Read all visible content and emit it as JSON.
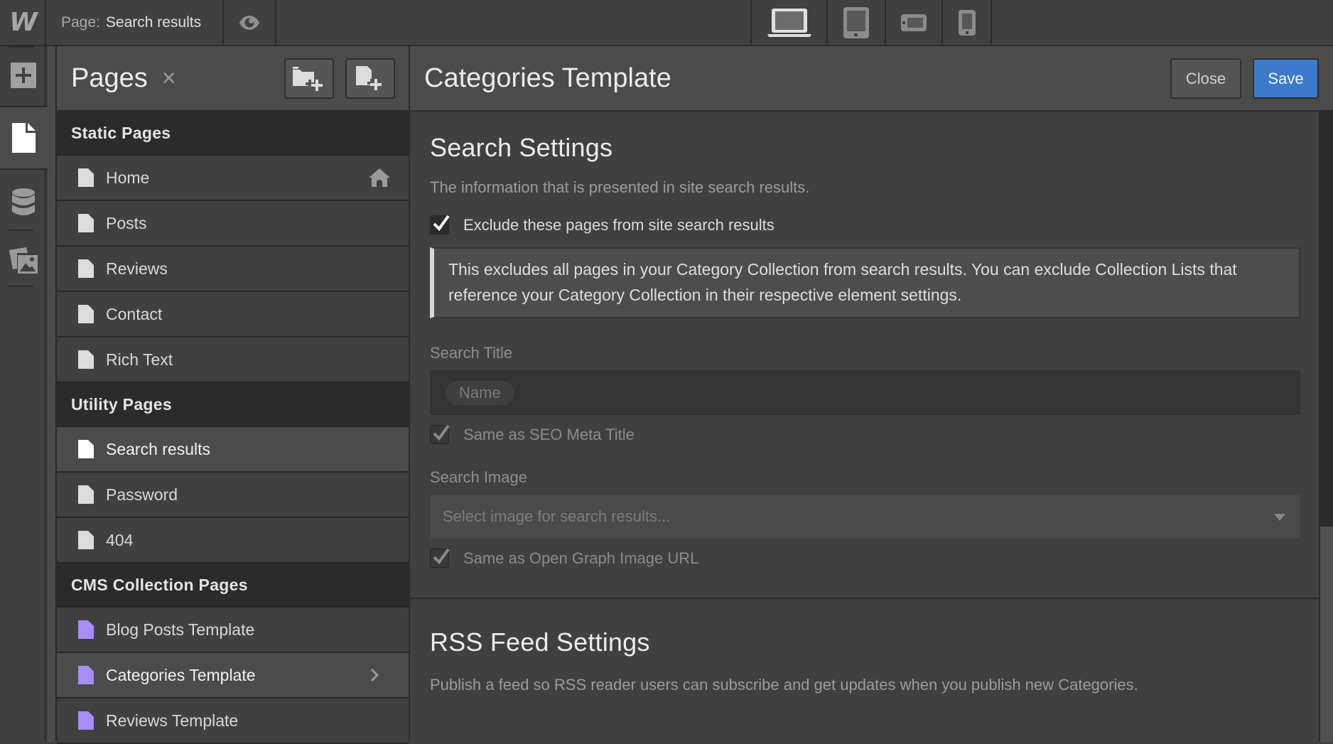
{
  "topbar": {
    "logo": "W",
    "page_prefix": "Page:",
    "page_name": "Search results",
    "preview_icon": "eye-icon",
    "devices": [
      {
        "name": "desktop",
        "icon": "laptop-icon",
        "active": true
      },
      {
        "name": "tablet",
        "icon": "tablet-icon",
        "active": false
      },
      {
        "name": "mobile-landscape",
        "icon": "phone-landscape-icon",
        "active": false
      },
      {
        "name": "mobile-portrait",
        "icon": "phone-portrait-icon",
        "active": false
      }
    ]
  },
  "rail": {
    "items": [
      {
        "name": "add-elements",
        "icon": "plus-icon",
        "active": false
      },
      {
        "name": "pages",
        "icon": "page-icon",
        "active": true
      },
      {
        "name": "cms",
        "icon": "database-icon",
        "active": false
      },
      {
        "name": "assets",
        "icon": "images-icon",
        "active": false
      }
    ]
  },
  "pages_panel": {
    "title": "Pages",
    "close_glyph": "×",
    "add_folder_icon": "folder-plus-icon",
    "add_page_icon": "page-plus-icon",
    "sections": [
      {
        "title": "Static Pages",
        "items": [
          {
            "label": "Home",
            "home": true
          },
          {
            "label": "Posts"
          },
          {
            "label": "Reviews"
          },
          {
            "label": "Contact"
          },
          {
            "label": "Rich Text"
          }
        ]
      },
      {
        "title": "Utility Pages",
        "items": [
          {
            "label": "Search results",
            "active": true
          },
          {
            "label": "Password"
          },
          {
            "label": "404"
          }
        ]
      },
      {
        "title": "CMS Collection Pages",
        "items": [
          {
            "label": "Blog Posts Template",
            "cms": true
          },
          {
            "label": "Categories Template",
            "cms": true,
            "active": true,
            "chevron": true
          },
          {
            "label": "Reviews Template",
            "cms": true
          }
        ]
      }
    ]
  },
  "settings": {
    "title": "Categories Template",
    "close_label": "Close",
    "save_label": "Save",
    "scroll_position": 0.66,
    "search": {
      "heading": "Search Settings",
      "description": "The information that is presented in site search results.",
      "exclude_label": "Exclude these pages from site search results",
      "exclude_checked": true,
      "note": "This excludes all pages in your Category Collection from search results. You can exclude Collection Lists that reference your Category Collection in their respective element settings.",
      "title_label": "Search Title",
      "title_token": "Name",
      "same_seo_label": "Same as SEO Meta Title",
      "same_seo_checked": true,
      "image_label": "Search Image",
      "image_placeholder": "Select image for search results...",
      "same_og_label": "Same as Open Graph Image URL",
      "same_og_checked": true
    },
    "rss": {
      "heading": "RSS Feed Settings",
      "description": "Publish a feed so RSS reader users can subscribe and get updates when you publish new Categories."
    }
  },
  "colors": {
    "accent": "#3b7bc9",
    "cms_page": "#a98cf5",
    "background": "#404040"
  }
}
